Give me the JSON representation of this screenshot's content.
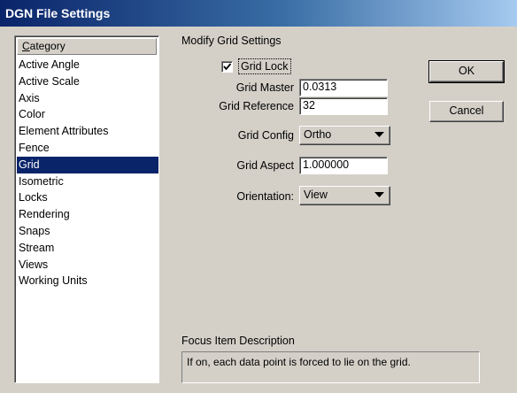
{
  "window": {
    "title": "DGN File Settings"
  },
  "category": {
    "header": "Category",
    "header_mnemonic": "C",
    "header_rest": "ategory",
    "items": [
      "Active Angle",
      "Active Scale",
      "Axis",
      "Color",
      "Element Attributes",
      "Fence",
      "Grid",
      "Isometric",
      "Locks",
      "Rendering",
      "Snaps",
      "Stream",
      "Views",
      "Working Units"
    ],
    "selected": "Grid"
  },
  "grid_settings": {
    "section_title": "Modify Grid Settings",
    "grid_lock": {
      "label": "Grid Lock",
      "checked": true
    },
    "grid_master": {
      "label": "Grid Master",
      "value": "0.0313"
    },
    "grid_reference": {
      "label": "Grid Reference",
      "value": "32"
    },
    "grid_config": {
      "label": "Grid Config",
      "value": "Ortho"
    },
    "grid_aspect": {
      "label": "Grid Aspect",
      "value": "1.000000"
    },
    "orientation": {
      "label": "Orientation:",
      "value": "View"
    }
  },
  "buttons": {
    "ok": "OK",
    "cancel": "Cancel"
  },
  "focus": {
    "label": "Focus Item Description",
    "description": "If on, each data point is forced to lie on the grid."
  },
  "colors": {
    "selection": "#0a246a",
    "face": "#d4d0c8",
    "title_start": "#0a246a"
  },
  "icons": {
    "check": "check-mark-icon",
    "dropdown": "triangle-down-icon"
  }
}
